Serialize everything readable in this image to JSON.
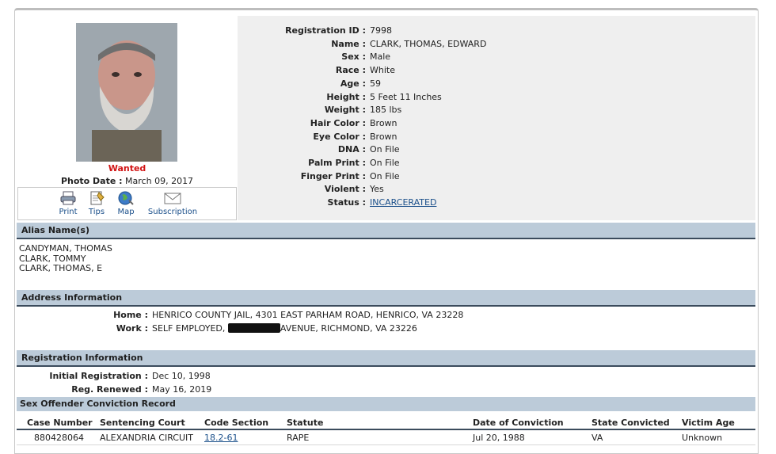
{
  "profile": {
    "status_flag": "Wanted",
    "photo_date_label": "Photo Date :",
    "photo_date_value": "March 09, 2017"
  },
  "actions": [
    {
      "label": "Print",
      "icon": "printer-icon"
    },
    {
      "label": "Tips",
      "icon": "notepad-icon"
    },
    {
      "label": "Map",
      "icon": "globe-icon"
    },
    {
      "label": "Subscription",
      "icon": "envelope-icon"
    }
  ],
  "details": [
    {
      "label": "Registration ID :",
      "value": "7998"
    },
    {
      "label": "Name :",
      "value": "CLARK, THOMAS, EDWARD"
    },
    {
      "label": "Sex :",
      "value": "Male"
    },
    {
      "label": "Race :",
      "value": "White"
    },
    {
      "label": "Age :",
      "value": "59"
    },
    {
      "label": "Height :",
      "value": "5 Feet 11 Inches"
    },
    {
      "label": "Weight :",
      "value": "185 lbs"
    },
    {
      "label": "Hair Color :",
      "value": "Brown"
    },
    {
      "label": "Eye Color :",
      "value": "Brown"
    },
    {
      "label": "DNA :",
      "value": "On File"
    },
    {
      "label": "Palm Print :",
      "value": "On File"
    },
    {
      "label": "Finger Print :",
      "value": "On File"
    },
    {
      "label": "Violent :",
      "value": "Yes"
    },
    {
      "label": "Status :",
      "value": "INCARCERATED"
    }
  ],
  "alias": {
    "title": "Alias Name(s)",
    "names": [
      "CANDYMAN, THOMAS",
      "CLARK, TOMMY",
      "CLARK, THOMAS, E"
    ]
  },
  "address": {
    "title": "Address Information",
    "home_label": "Home :",
    "home_value": "HENRICO COUNTY JAIL, 4301 EAST PARHAM ROAD, HENRICO, VA 23228",
    "work_label": "Work :",
    "work_prefix": "SELF EMPLOYED, ",
    "work_suffix": "AVENUE, RICHMOND, VA 23226"
  },
  "registration": {
    "title": "Registration Information",
    "initial_label": "Initial Registration :",
    "initial_value": "Dec 10, 1998",
    "renewed_label": "Reg. Renewed :",
    "renewed_value": "May 16, 2019"
  },
  "conviction": {
    "title": "Sex Offender Conviction Record",
    "headers": [
      "Case Number",
      "Sentencing Court",
      "Code Section",
      "Statute",
      "Date of Conviction",
      "State Convicted",
      "Victim Age"
    ],
    "rows": [
      [
        "880428064",
        "ALEXANDRIA CIRCUIT",
        "18.2-61",
        "RAPE",
        "Jul 20, 1988",
        "VA",
        "Unknown"
      ]
    ]
  },
  "colors": {
    "wanted": "#d21414",
    "link": "#1a4f8a",
    "section_header_bg": "#bccbd9"
  }
}
